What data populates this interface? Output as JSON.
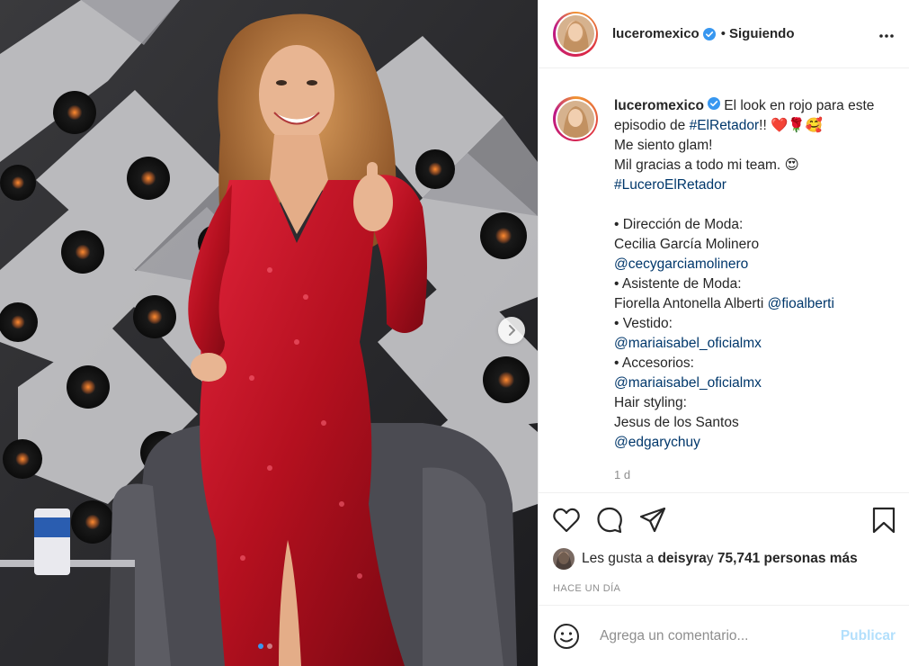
{
  "post": {
    "username": "luceromexico",
    "follow_separator": "•",
    "follow_status": "Siguiendo",
    "more_icon": "more-horizontal-icon",
    "verified_icon": "verified-badge-icon"
  },
  "caption": {
    "username": "luceromexico",
    "line1": " El look en rojo para este episodio de ",
    "hashtag1": "#ElRetador",
    "line1b": "!! ",
    "emoji1": "❤️🌹🥰",
    "line2": "Me siento glam!",
    "line3": "Mil gracias a todo mi team. ",
    "emoji2": "😍",
    "hashtag2": "#LuceroElRetador",
    "credits": [
      {
        "role": "• Dirección de Moda:",
        "name": "Cecilia García Molinero",
        "handle": "@cecygarciamolinero"
      },
      {
        "role": "• Asistente de Moda:",
        "name": "Fiorella Antonella Alberti ",
        "handle": "@fioalberti"
      },
      {
        "role": "• Vestido:",
        "name": "",
        "handle": "@mariaisabel_oficialmx"
      },
      {
        "role": "• Accesorios:",
        "name": "",
        "handle": "@mariaisabel_oficialmx"
      },
      {
        "role": "Hair styling:",
        "name": "Jesus de los Santos",
        "handle": "@edgarychuy"
      }
    ],
    "time": "1 d"
  },
  "actions": {
    "like_icon": "heart-icon",
    "comment_icon": "comment-icon",
    "share_icon": "share-icon",
    "save_icon": "bookmark-icon"
  },
  "likes": {
    "prefix": "Les gusta a ",
    "user": "deisyra",
    "conj": " y ",
    "count": "75,741 personas más"
  },
  "ago": "HACE UN DÍA",
  "comment": {
    "placeholder": "Agrega un comentario...",
    "publish": "Publicar",
    "emoji_icon": "smiley-icon"
  },
  "carousel": {
    "next_icon": "chevron-right-icon",
    "slide_count": 2,
    "active_slide": 1
  },
  "colors": {
    "link": "#00376b",
    "dress": "#c8102e",
    "publish_disabled": "#b2dffc",
    "carousel_active": "#3897f0"
  }
}
